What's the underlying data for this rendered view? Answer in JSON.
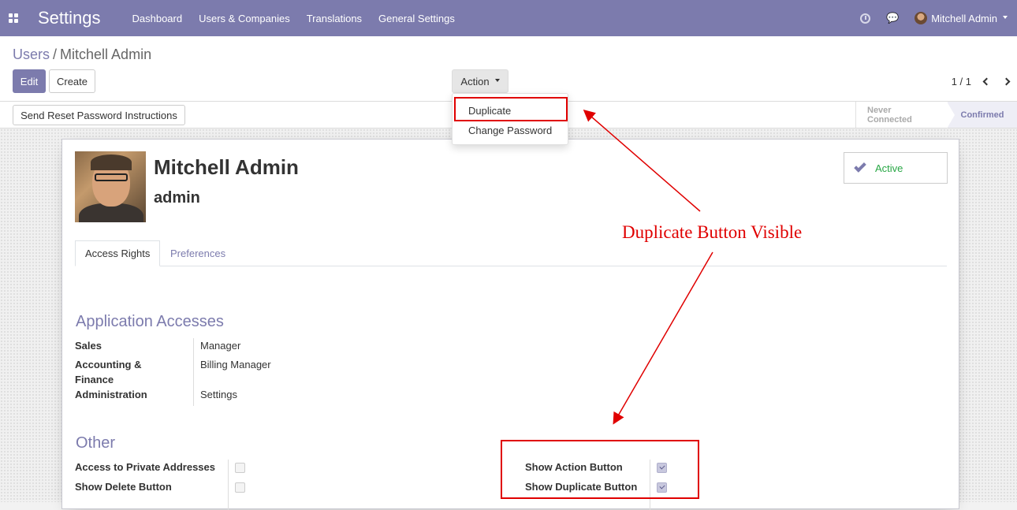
{
  "navbar": {
    "app_title": "Settings",
    "menu": [
      "Dashboard",
      "Users & Companies",
      "Translations",
      "General Settings"
    ],
    "user_name": "Mitchell Admin",
    "icons": {
      "apps": "apps-grid-icon",
      "activity": "clock-icon",
      "messages": "chat-icon"
    }
  },
  "breadcrumb": {
    "parent": "Users",
    "separator": "/",
    "current": "Mitchell Admin"
  },
  "toolbar": {
    "edit_label": "Edit",
    "create_label": "Create",
    "action_label": "Action"
  },
  "pager": {
    "value": "1 / 1"
  },
  "action_menu": {
    "items": [
      "Duplicate",
      "Change Password"
    ],
    "highlighted": "Duplicate"
  },
  "statusbar": {
    "reset_button": "Send Reset Password Instructions",
    "stages": [
      "Never Connected",
      "Confirmed"
    ],
    "current_stage": "Confirmed"
  },
  "record": {
    "name": "Mitchell Admin",
    "login": "admin",
    "active_label": "Active"
  },
  "tabs": [
    "Access Rights",
    "Preferences"
  ],
  "app_accesses": {
    "title": "Application Accesses",
    "rows": [
      {
        "label": "Sales",
        "value": "Manager"
      },
      {
        "label": "Accounting & Finance",
        "value": "Billing Manager"
      },
      {
        "label": "Administration",
        "value": "Settings"
      }
    ]
  },
  "other": {
    "title": "Other",
    "left": [
      {
        "label": "Access to Private Addresses",
        "checked": false
      },
      {
        "label": "Show Delete Button",
        "checked": false
      }
    ],
    "right": [
      {
        "label": "Show Action Button",
        "checked": true
      },
      {
        "label": "Show Duplicate Button",
        "checked": true
      }
    ]
  },
  "annotation": {
    "text": "Duplicate Button Visible",
    "color": "#e00000"
  },
  "colors": {
    "brand": "#7c7bad",
    "active": "#28a745",
    "annotation": "#e00000"
  }
}
